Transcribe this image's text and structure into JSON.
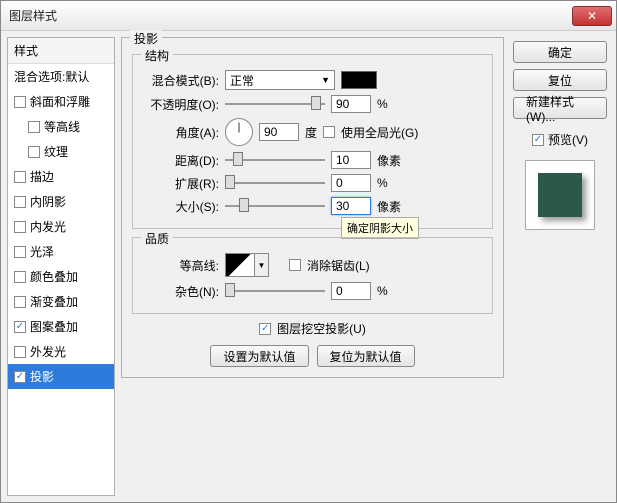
{
  "window": {
    "title": "图层样式"
  },
  "sidebar": {
    "header": "样式",
    "blend_defaults": "混合选项:默认",
    "items": [
      {
        "label": "斜面和浮雕",
        "checked": false
      },
      {
        "label": "等高线",
        "checked": false,
        "indent": true
      },
      {
        "label": "纹理",
        "checked": false,
        "indent": true
      },
      {
        "label": "描边",
        "checked": false
      },
      {
        "label": "内阴影",
        "checked": false
      },
      {
        "label": "内发光",
        "checked": false
      },
      {
        "label": "光泽",
        "checked": false
      },
      {
        "label": "颜色叠加",
        "checked": false
      },
      {
        "label": "渐变叠加",
        "checked": false
      },
      {
        "label": "图案叠加",
        "checked": true
      },
      {
        "label": "外发光",
        "checked": false
      },
      {
        "label": "投影",
        "checked": true,
        "selected": true
      }
    ]
  },
  "panel": {
    "title": "投影",
    "structure": {
      "title": "结构",
      "blend_mode_label": "混合模式(B):",
      "blend_mode_value": "正常",
      "opacity_label": "不透明度(O):",
      "opacity_value": "90",
      "opacity_unit": "%",
      "angle_label": "角度(A):",
      "angle_value": "90",
      "angle_unit": "度",
      "global_light_label": "使用全局光(G)",
      "distance_label": "距离(D):",
      "distance_value": "10",
      "distance_unit": "像素",
      "spread_label": "扩展(R):",
      "spread_value": "0",
      "spread_unit": "%",
      "size_label": "大小(S):",
      "size_value": "30",
      "size_unit": "像素"
    },
    "quality": {
      "title": "品质",
      "contour_label": "等高线:",
      "antialias_label": "消除锯齿(L)",
      "noise_label": "杂色(N):",
      "noise_value": "0",
      "noise_unit": "%"
    },
    "knockout_label": "图层挖空投影(U)",
    "set_default": "设置为默认值",
    "reset_default": "复位为默认值",
    "tooltip": "确定阴影大小"
  },
  "right": {
    "ok": "确定",
    "cancel": "复位",
    "new_style": "新建样式(W)...",
    "preview_label": "预览(V)"
  }
}
